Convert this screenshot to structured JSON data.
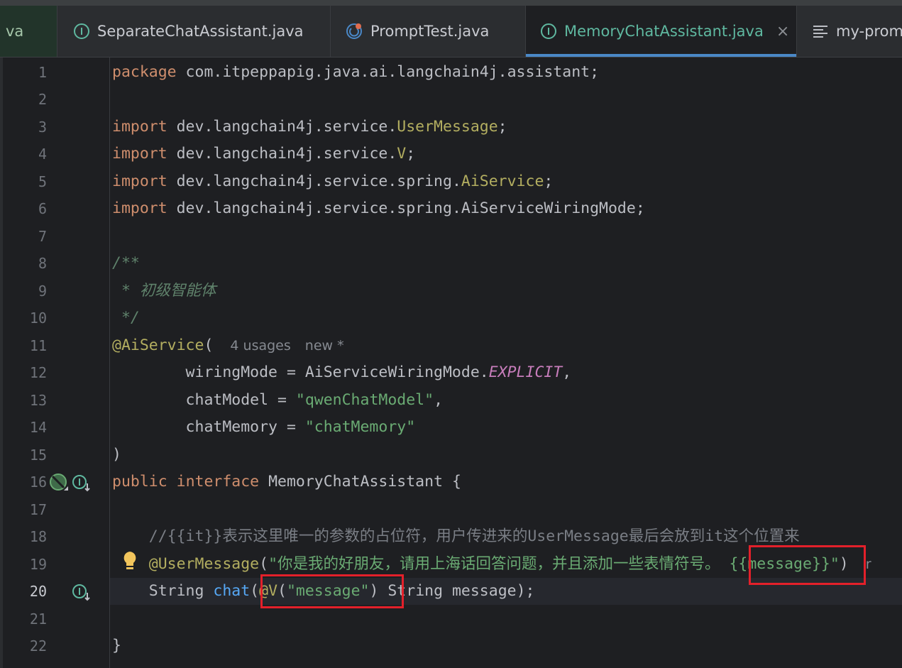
{
  "tabs": [
    {
      "label": "va",
      "icon": "none",
      "state": "partial"
    },
    {
      "label": "SeparateChatAssistant.java",
      "icon": "interface-icon"
    },
    {
      "label": "PromptTest.java",
      "icon": "test-class-icon"
    },
    {
      "label": "MemoryChatAssistant.java",
      "icon": "interface-icon",
      "active": true,
      "close": "×"
    },
    {
      "label": "my-prom",
      "icon": "text-file-icon",
      "state": "partial"
    }
  ],
  "editor": {
    "current_line": 20,
    "line_numbers": [
      "1",
      "2",
      "3",
      "4",
      "5",
      "6",
      "7",
      "8",
      "9",
      "10",
      "11",
      "12",
      "13",
      "14",
      "15",
      "16",
      "17",
      "18",
      "19",
      "20",
      "21",
      "22"
    ],
    "code": {
      "l1": {
        "kw": "package",
        "rest": " com.itpeppapig.java.ai.langchain4j.assistant;"
      },
      "l3": {
        "kw": "import",
        "pre": " dev.langchain4j.service.",
        "cls": "UserMessage",
        "post": ";"
      },
      "l4": {
        "kw": "import",
        "pre": " dev.langchain4j.service.",
        "cls": "V",
        "post": ";"
      },
      "l5": {
        "kw": "import",
        "pre": " dev.langchain4j.service.spring.",
        "cls": "AiService",
        "post": ";"
      },
      "l6": {
        "kw": "import",
        "pre": " dev.langchain4j.service.spring.AiServiceWiringMode;"
      },
      "l8": "/**",
      "l9": " * 初级智能体",
      "l10": " */",
      "l11": {
        "ann": "@AiService",
        "paren": "(",
        "hint_usages": "4 usages",
        "hint_author": "new *"
      },
      "l12": {
        "pre": "        wiringMode = AiServiceWiringMode.",
        "stat": "EXPLICIT",
        "post": ","
      },
      "l13": {
        "pre": "        chatModel = ",
        "str": "\"qwenChatModel\"",
        "post": ","
      },
      "l14": {
        "pre": "        chatMemory = ",
        "str": "\"chatMemory\""
      },
      "l15": ")",
      "l16": {
        "kw1": "public",
        "kw2": "interface",
        "name": " MemoryChatAssistant {"
      },
      "l18": {
        "cm": "    //{{it}}表示这里唯一的参数的占位符，用户传进来的UserMessage最后会放到it这个位置来"
      },
      "l19": {
        "ann": "    @UserMessage",
        "open": "(",
        "str": "\"你是我的好朋友，请用上海话回答问题，并且添加一些表情符号。 {{message}}\"",
        "close": ")",
        "tail": "r"
      },
      "l20": {
        "pre": "    String ",
        "fn": "chat",
        "open": "(",
        "ann": "@V",
        "arg_open": "(",
        "str": "\"message\"",
        "arg_close": ")",
        "post": " String message);"
      },
      "l22": "}"
    }
  },
  "colors": {
    "background": "#1e1f22",
    "keyword": "#cf8e6d",
    "annotation": "#b3ae60",
    "string": "#6aab73",
    "highlight_box": "#e3202a",
    "active_tab_text": "#5fb8a0"
  }
}
